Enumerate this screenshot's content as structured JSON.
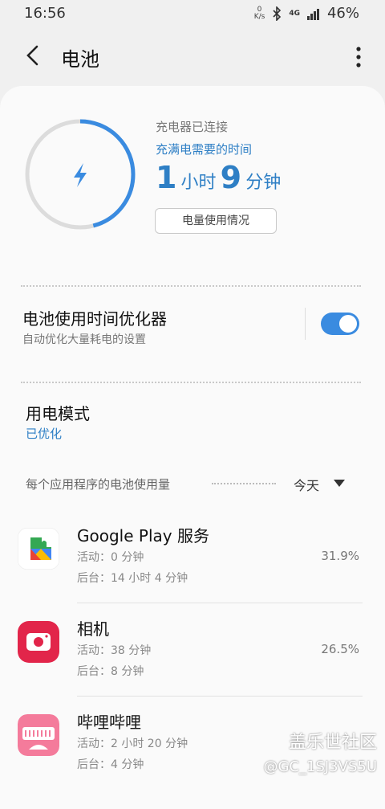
{
  "status_bar": {
    "time": "16:56",
    "speed_top": "0",
    "speed_unit": "K/s",
    "network": "4G",
    "battery": "46%"
  },
  "app_bar": {
    "title": "电池"
  },
  "charge": {
    "state": "充电器已连接",
    "time_label": "充满电需要的时间",
    "hours": "1",
    "hours_unit": "小时",
    "minutes": "9",
    "minutes_unit": "分钟",
    "usage_button": "电量使用情况",
    "ring_progress": 0.46,
    "accent": "#3a8be0"
  },
  "optimizer": {
    "title": "电池使用时间优化器",
    "subtitle": "自动优化大量耗电的设置",
    "enabled": true
  },
  "power_mode": {
    "title": "用电模式",
    "value": "已优化"
  },
  "usage_section": {
    "header": "每个应用程序的电池使用量",
    "period": "今天"
  },
  "apps": [
    {
      "name": "Google Play 服务",
      "active": "活动：0 分钟",
      "background": "后台：14 小时 4 分钟",
      "percent": "31.9%",
      "icon": "google-play-services-icon"
    },
    {
      "name": "相机",
      "active": "活动：38 分钟",
      "background": "后台：8 分钟",
      "percent": "26.5%",
      "icon": "camera-app-icon"
    },
    {
      "name": "哔哩哔哩",
      "active": "活动：2 小时 20 分钟",
      "background": "后台：4 分钟",
      "percent": "",
      "icon": "bilibili-icon"
    }
  ],
  "watermark": {
    "line1": "盖乐世社区",
    "line2": "@GC_1SJ3VS5U"
  }
}
